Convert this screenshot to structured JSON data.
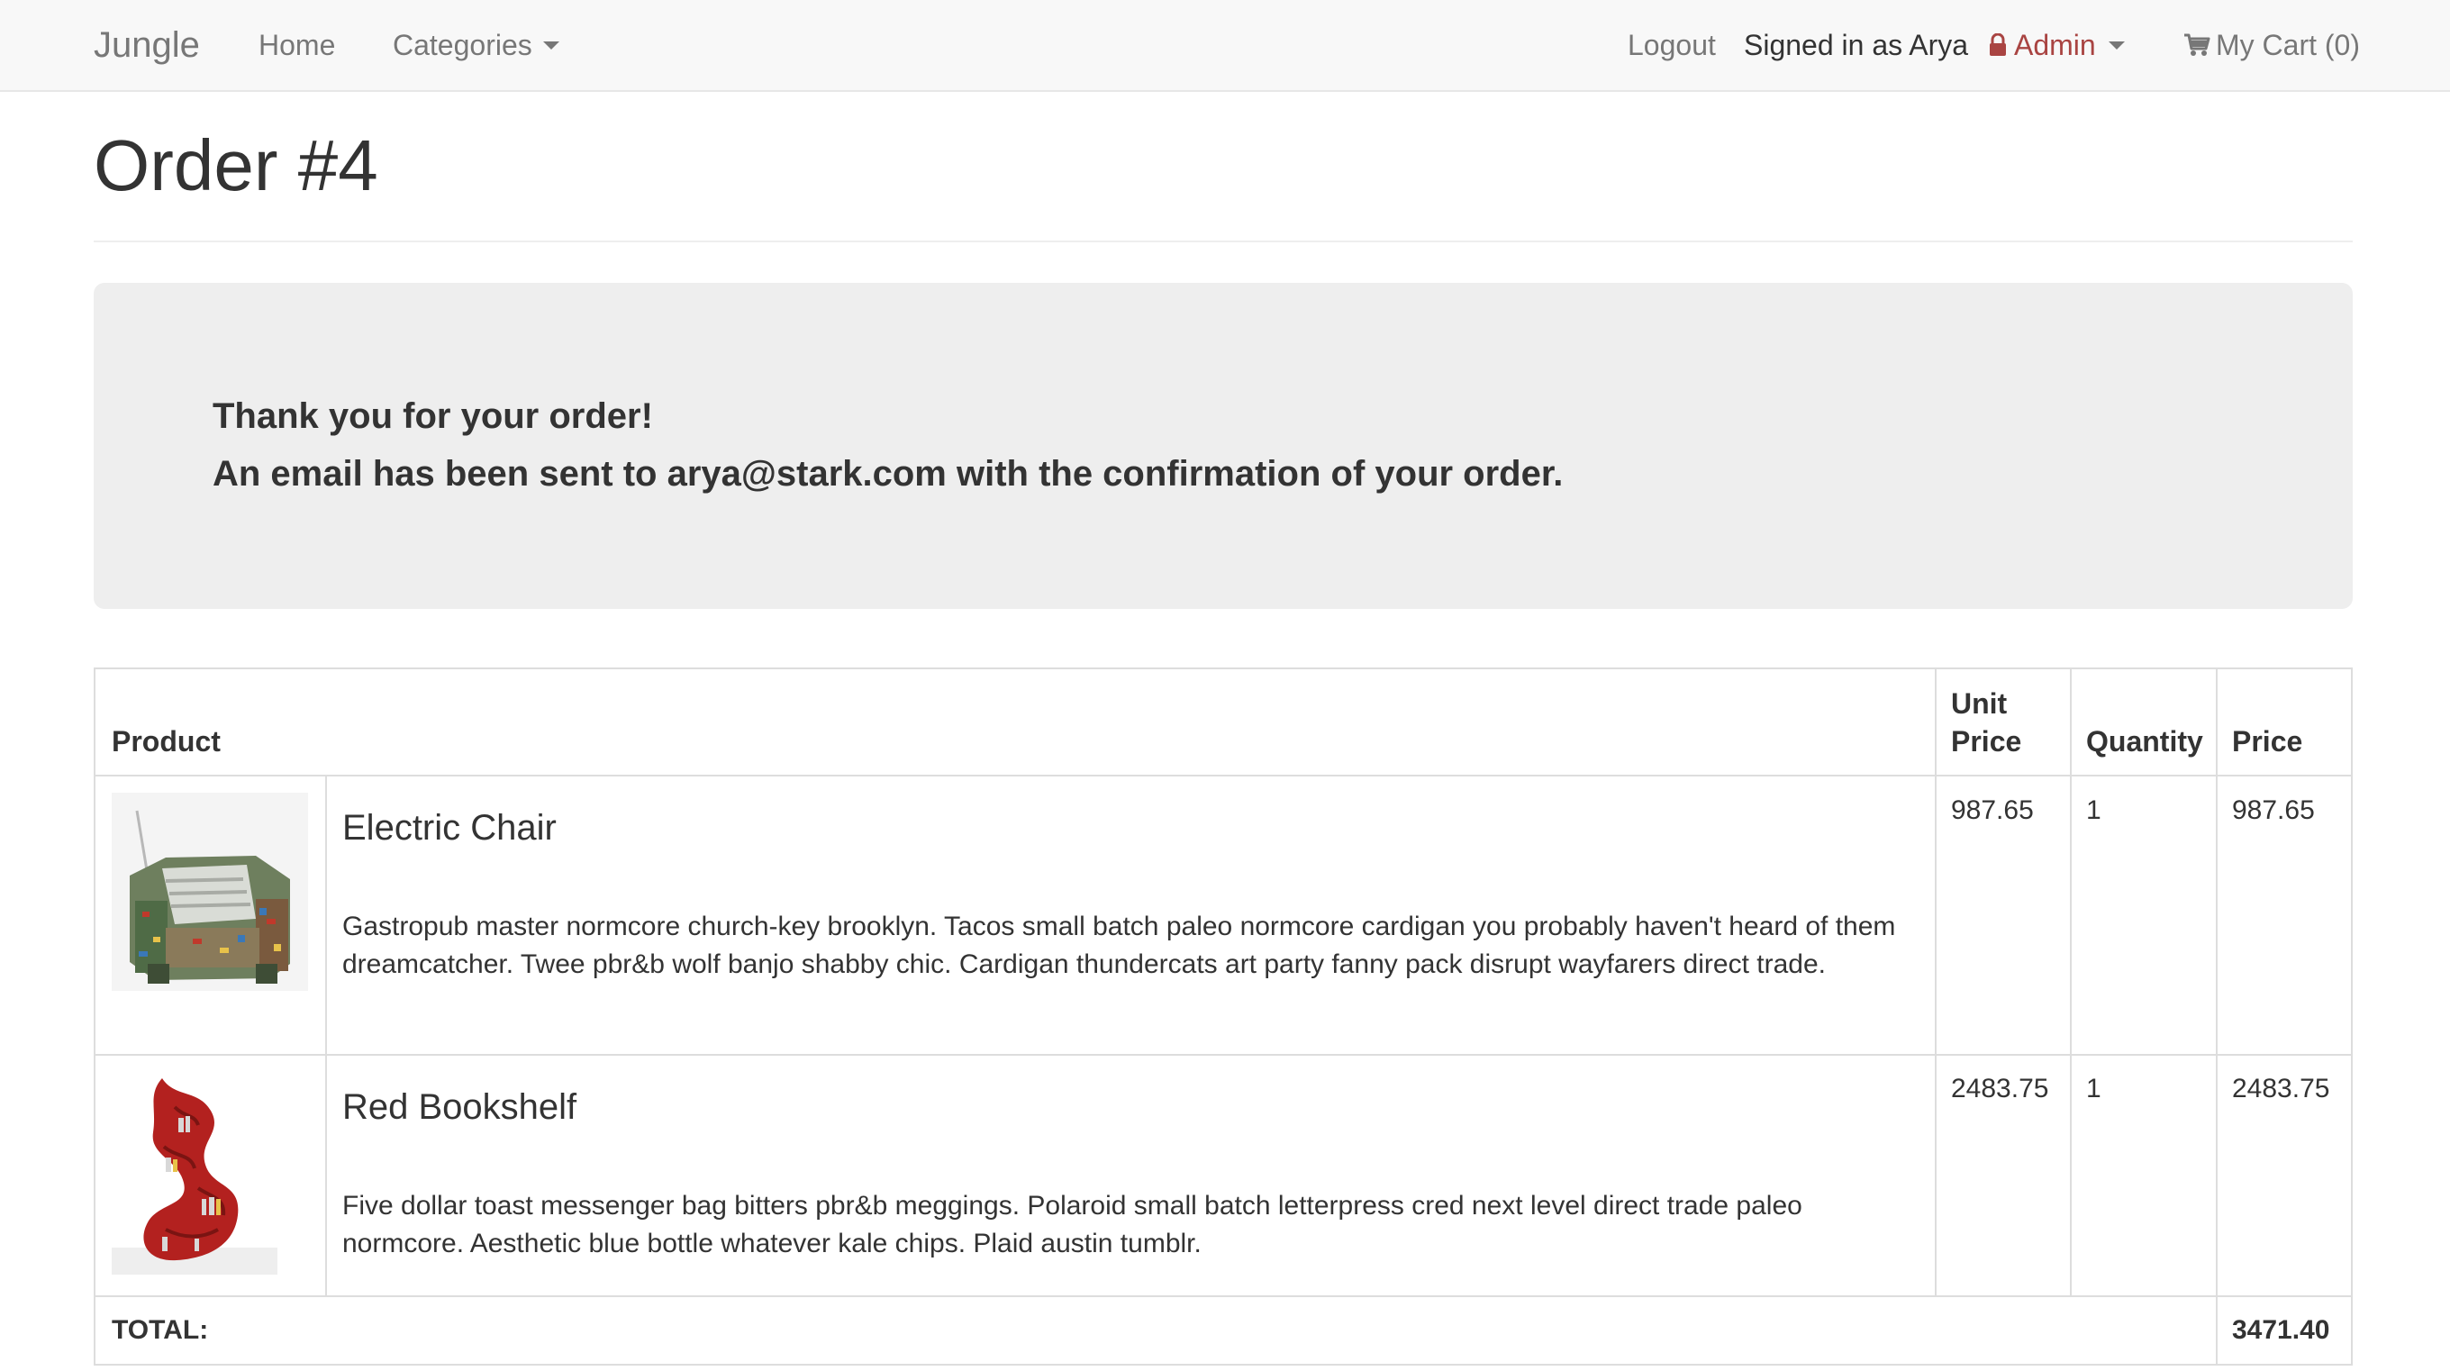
{
  "nav": {
    "brand": "Jungle",
    "home": "Home",
    "categories": "Categories",
    "logout": "Logout",
    "signed_in": "Signed in as Arya",
    "admin": "Admin",
    "cart": "My Cart (0)"
  },
  "page": {
    "title": "Order #4"
  },
  "confirmation": {
    "line1": "Thank you for your order!",
    "line2": "An email has been sent to arya@stark.com with the confirmation of your order."
  },
  "table": {
    "headers": {
      "product": "Product",
      "unit_price_1": "Unit",
      "unit_price_2": "Price",
      "quantity": "Quantity",
      "price": "Price"
    },
    "items": [
      {
        "name": "Electric Chair",
        "description": "Gastropub master normcore church-key brooklyn. Tacos small batch paleo normcore cardigan you probably haven't heard of them dreamcatcher. Twee pbr&b wolf banjo shabby chic. Cardigan thundercats art party fanny pack disrupt wayfarers direct trade.",
        "unit_price": "987.65",
        "quantity": "1",
        "price": "987.65"
      },
      {
        "name": "Red Bookshelf",
        "description": "Five dollar toast messenger bag bitters pbr&b meggings. Polaroid small batch letterpress cred next level direct trade paleo normcore. Aesthetic blue bottle whatever kale chips. Plaid austin tumblr.",
        "unit_price": "2483.75",
        "quantity": "1",
        "price": "2483.75"
      }
    ],
    "total_label": "TOTAL:",
    "total_value": "3471.40"
  },
  "colors": {
    "navbar_bg": "#f8f8f8",
    "admin_accent": "#a94442",
    "jumbotron_bg": "#eeeeee",
    "table_border": "#dddddd"
  }
}
